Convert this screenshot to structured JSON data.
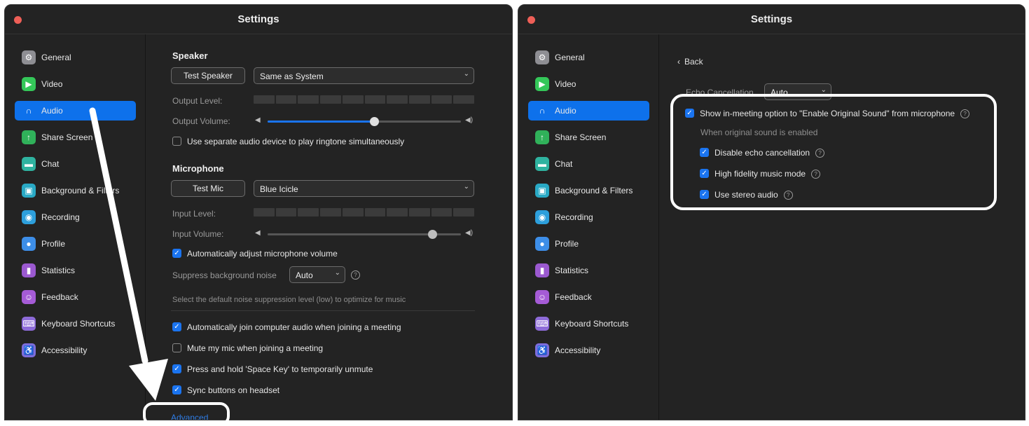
{
  "window_title": "Settings",
  "sidebar": {
    "items": [
      {
        "label": "General",
        "icon": "gear-icon",
        "color": "#8e8e93",
        "glyph": "⚙"
      },
      {
        "label": "Video",
        "icon": "video-camera-icon",
        "color": "#34c759",
        "glyph": "▶"
      },
      {
        "label": "Audio",
        "icon": "headphones-icon",
        "color": "#0e71eb",
        "glyph": "∩"
      },
      {
        "label": "Share Screen",
        "icon": "share-screen-icon",
        "color": "#30b15a",
        "glyph": "↑"
      },
      {
        "label": "Chat",
        "icon": "chat-bubble-icon",
        "color": "#2fb3a0",
        "glyph": "▬"
      },
      {
        "label": "Background & Filters",
        "icon": "background-icon",
        "color": "#29a9c5",
        "glyph": "▣"
      },
      {
        "label": "Recording",
        "icon": "recording-icon",
        "color": "#2d9fdc",
        "glyph": "◉"
      },
      {
        "label": "Profile",
        "icon": "profile-icon",
        "color": "#3d8ee8",
        "glyph": "●"
      },
      {
        "label": "Statistics",
        "icon": "statistics-icon",
        "color": "#9b59d0",
        "glyph": "▮"
      },
      {
        "label": "Feedback",
        "icon": "feedback-icon",
        "color": "#a55bd6",
        "glyph": "☺"
      },
      {
        "label": "Keyboard Shortcuts",
        "icon": "keyboard-icon",
        "color": "#8d6bd8",
        "glyph": "⌨"
      },
      {
        "label": "Accessibility",
        "icon": "accessibility-icon",
        "color": "#7d6ddb",
        "glyph": "♿"
      }
    ],
    "active_index": 2
  },
  "left": {
    "speaker": {
      "title": "Speaker",
      "test_button": "Test Speaker",
      "device": "Same as System",
      "output_level_label": "Output Level:",
      "output_volume_label": "Output Volume:",
      "volume": 0.55,
      "separate_device_label": "Use separate audio device to play ringtone simultaneously"
    },
    "microphone": {
      "title": "Microphone",
      "test_button": "Test Mic",
      "device": "Blue Icicle",
      "input_level_label": "Input Level:",
      "input_volume_label": "Input Volume:",
      "volume": 0.85,
      "auto_adjust_label": "Automatically adjust microphone volume",
      "suppress_label": "Suppress background noise",
      "suppress_value": "Auto",
      "suppress_hint": "Select the default noise suppression level (low) to optimize for music"
    },
    "options": [
      {
        "label": "Automatically join computer audio when joining a meeting",
        "checked": true
      },
      {
        "label": "Mute my mic when joining a meeting",
        "checked": false
      },
      {
        "label": "Press and hold 'Space Key' to temporarily unmute",
        "checked": true
      },
      {
        "label": "Sync buttons on headset",
        "checked": true
      }
    ],
    "advanced_link": "Advanced"
  },
  "right": {
    "back_label": "Back",
    "echo_label": "Echo Cancellation",
    "echo_value": "Auto",
    "original_sound_label": "Show in-meeting option to \"Enable Original Sound\" from microphone",
    "when_enabled_label": "When original sound is enabled",
    "sub_options": [
      {
        "label": "Disable echo cancellation",
        "checked": true
      },
      {
        "label": "High fidelity music mode",
        "checked": true
      },
      {
        "label": "Use stereo audio",
        "checked": true
      }
    ]
  }
}
